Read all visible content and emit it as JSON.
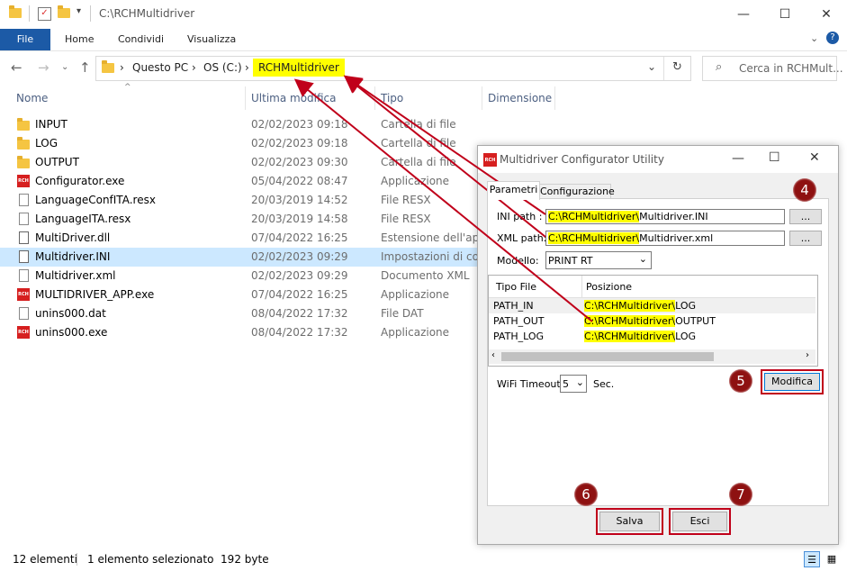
{
  "explorer": {
    "title": "C:\\RCHMultidriver",
    "ribbon_tabs": [
      "File",
      "Home",
      "Condividi",
      "Visualizza"
    ],
    "breadcrumb": [
      "Questo PC",
      "OS (C:)",
      "RCHMultidriver"
    ],
    "search_placeholder": "Cerca in RCHMult...",
    "columns": [
      "Nome",
      "Ultima modifica",
      "Tipo",
      "Dimensione"
    ],
    "files": [
      {
        "name": "INPUT",
        "date": "02/02/2023 09:18",
        "type": "Cartella di file",
        "icon": "folder-icon"
      },
      {
        "name": "LOG",
        "date": "02/02/2023 09:18",
        "type": "Cartella di file",
        "icon": "folder-icon"
      },
      {
        "name": "OUTPUT",
        "date": "02/02/2023 09:30",
        "type": "Cartella di file",
        "icon": "folder-icon"
      },
      {
        "name": "Configurator.exe",
        "date": "05/04/2022 08:47",
        "type": "Applicazione",
        "icon": "rch-app-icon"
      },
      {
        "name": "LanguageConfITA.resx",
        "date": "20/03/2019 14:52",
        "type": "File RESX",
        "icon": "document-icon"
      },
      {
        "name": "LanguageITA.resx",
        "date": "20/03/2019 14:58",
        "type": "File RESX",
        "icon": "document-icon"
      },
      {
        "name": "MultiDriver.dll",
        "date": "07/04/2022 16:25",
        "type": "Estensione dell'ap...",
        "icon": "dll-icon"
      },
      {
        "name": "Multidriver.INI",
        "date": "02/02/2023 09:29",
        "type": "Impostazioni di co...",
        "icon": "ini-icon"
      },
      {
        "name": "Multidriver.xml",
        "date": "02/02/2023 09:29",
        "type": "Documento XML",
        "icon": "document-icon"
      },
      {
        "name": "MULTIDRIVER_APP.exe",
        "date": "07/04/2022 16:25",
        "type": "Applicazione",
        "icon": "rch-app-icon"
      },
      {
        "name": "unins000.dat",
        "date": "08/04/2022 17:32",
        "type": "File DAT",
        "icon": "document-icon"
      },
      {
        "name": "unins000.exe",
        "date": "08/04/2022 17:32",
        "type": "Applicazione",
        "icon": "rch-app-icon"
      }
    ],
    "selected_index": 7,
    "status_count": "12 elementi",
    "status_selection": "1 elemento selezionato  192 byte"
  },
  "dialog": {
    "title": "Multidriver Configurator Utility",
    "tabs": [
      "Parametri",
      "Configurazione"
    ],
    "ini_label": "INI path :",
    "ini_highlight": "C:\\RCHMultidriver\\",
    "ini_rest": "Multidriver.INI",
    "xml_label": "XML path:",
    "xml_highlight": "C:\\RCHMultidriver\\",
    "xml_rest": "Multidriver.xml",
    "browse_label": "...",
    "model_label": "Modello:",
    "model_value": "PRINT RT",
    "grid_headers": [
      "Tipo File",
      "Posizione"
    ],
    "grid_rows": [
      {
        "type": "PATH_IN",
        "hl": "C:\\RCHMultidriver\\",
        "rest": "LOG"
      },
      {
        "type": "PATH_OUT",
        "hl": "C:\\RCHMultidriver\\",
        "rest": "OUTPUT"
      },
      {
        "type": "PATH_LOG",
        "hl": "C:\\RCHMultidriver\\",
        "rest": "LOG"
      }
    ],
    "wifi_label": "WiFi Timeout",
    "wifi_value": "5",
    "wifi_unit": "Sec.",
    "modify_label": "Modifica",
    "save_label": "Salva",
    "exit_label": "Esci"
  },
  "annotations": [
    "4",
    "5",
    "6",
    "7"
  ],
  "colors": {
    "highlight": "#ffff00",
    "annotation": "#8e1111",
    "accent": "#1c5aa6",
    "rch_red": "#d61f1f"
  }
}
